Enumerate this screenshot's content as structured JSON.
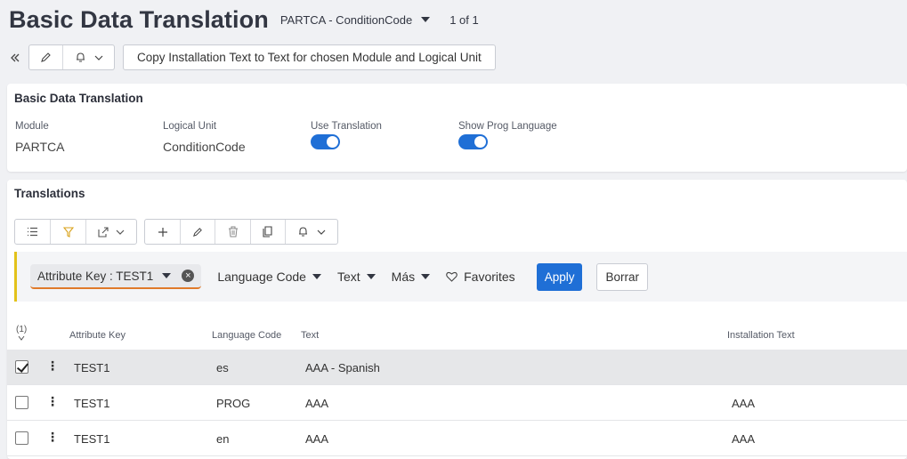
{
  "header": {
    "title": "Basic Data Translation",
    "record": "PARTCA - ConditionCode",
    "count": "1 of 1"
  },
  "toolbar": {
    "copy_label": "Copy Installation Text to Text for chosen Module and Logical Unit"
  },
  "details": {
    "title": "Basic Data Translation",
    "module_label": "Module",
    "module_value": "PARTCA",
    "lu_label": "Logical Unit",
    "lu_value": "ConditionCode",
    "use_translation_label": "Use Translation",
    "use_translation_on": true,
    "show_prog_label": "Show Prog Language",
    "show_prog_on": true
  },
  "translations": {
    "title": "Translations",
    "filter": {
      "chip": "Attribute Key : TEST1",
      "language_code": "Language Code",
      "text": "Text",
      "mas": "Más",
      "favorites": "Favorites",
      "apply": "Apply",
      "borrar": "Borrar"
    },
    "selected_count": "(1)",
    "columns": [
      "Attribute Key",
      "Language Code",
      "Text",
      "Installation Text"
    ],
    "rows": [
      {
        "key": "TEST1",
        "lang": "es",
        "text": "AAA - Spanish",
        "install": "",
        "selected": true
      },
      {
        "key": "TEST1",
        "lang": "PROG",
        "text": "AAA",
        "install": "AAA",
        "selected": false
      },
      {
        "key": "TEST1",
        "lang": "en",
        "text": "AAA",
        "install": "AAA",
        "selected": false
      }
    ]
  },
  "colors": {
    "accent": "#1f6fd6",
    "filter_bar": "#e3c21a",
    "chip_underline": "#e07a2a"
  }
}
